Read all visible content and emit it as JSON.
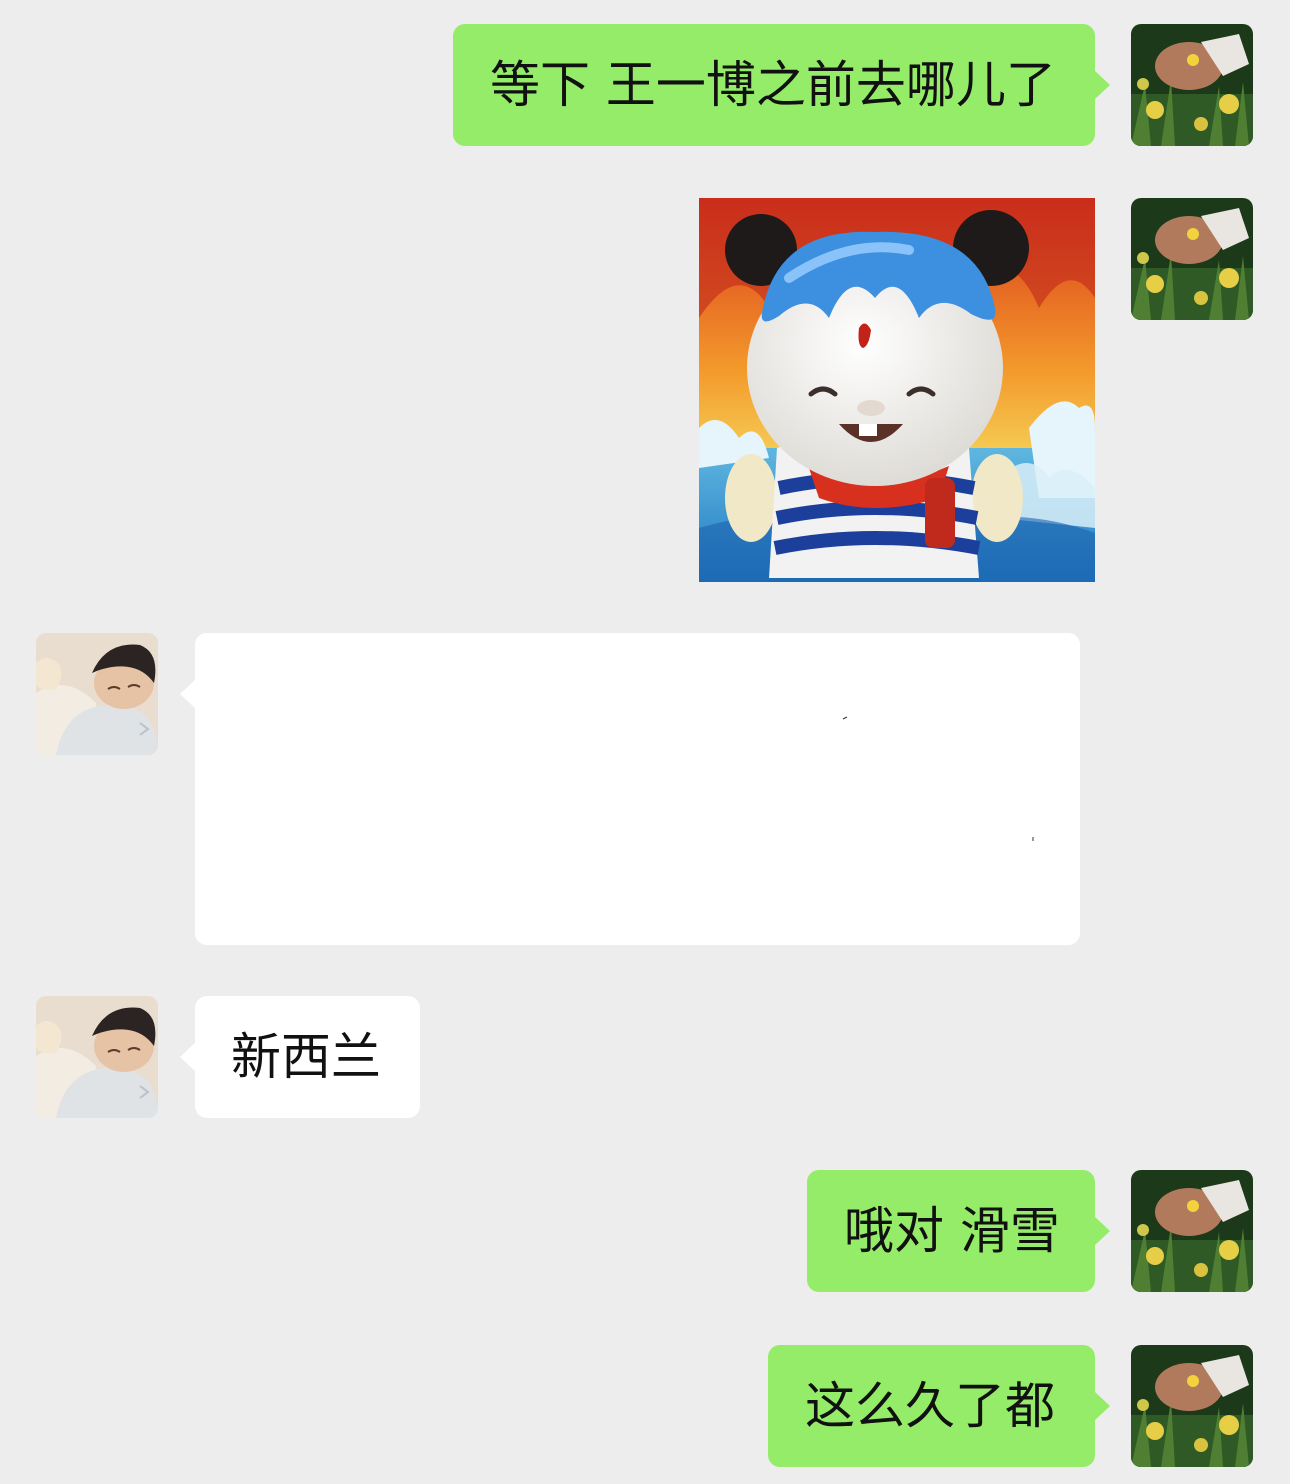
{
  "chat": {
    "colors": {
      "background": "#ededed",
      "self_bubble": "#95ec69",
      "other_bubble": "#ffffff"
    },
    "messages": [
      {
        "sender": "self",
        "type": "text",
        "text": "等下 王一博之前去哪儿了"
      },
      {
        "sender": "self",
        "type": "sticker",
        "icon": "water-bear-sticker"
      },
      {
        "sender": "other",
        "type": "image",
        "icon": "blank-white-image"
      },
      {
        "sender": "other",
        "type": "text",
        "text": "新西兰"
      },
      {
        "sender": "self",
        "type": "text",
        "text": "哦对 滑雪"
      },
      {
        "sender": "self",
        "type": "text",
        "text": "这么久了都"
      }
    ]
  }
}
